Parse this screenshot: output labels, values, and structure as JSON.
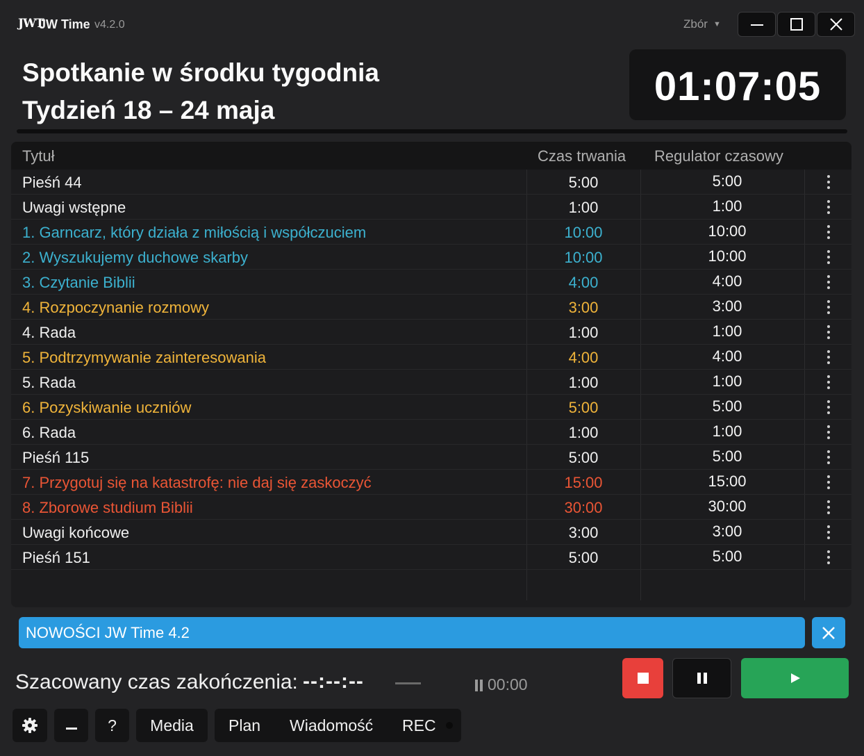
{
  "app": {
    "logo": "JWT",
    "name": "JW Time",
    "version": "v4.2.0",
    "congregation_selector": "Zbór"
  },
  "header": {
    "title_line1": "Spotkanie w środku tygodnia",
    "title_line2": "Tydzień 18 – 24 maja",
    "clock": "01:07:05"
  },
  "table": {
    "columns": {
      "title": "Tytuł",
      "duration": "Czas trwania",
      "regulator": "Regulator czasowy"
    },
    "rows": [
      {
        "title": "Pieśń 44",
        "duration": "5:00",
        "regulator": "5:00",
        "color": "#f0f0f0"
      },
      {
        "title": "Uwagi wstępne",
        "duration": "1:00",
        "regulator": "1:00",
        "color": "#f0f0f0"
      },
      {
        "title": "1. Garncarz, który działa z miłością i współczuciem",
        "duration": "10:00",
        "regulator": "10:00",
        "color": "#3cb1cf"
      },
      {
        "title": "2. Wyszukujemy duchowe skarby",
        "duration": "10:00",
        "regulator": "10:00",
        "color": "#3cb1cf"
      },
      {
        "title": "3. Czytanie Biblii",
        "duration": "4:00",
        "regulator": "4:00",
        "color": "#3cb1cf"
      },
      {
        "title": "4. Rozpoczynanie rozmowy",
        "duration": "3:00",
        "regulator": "3:00",
        "color": "#f0b43a"
      },
      {
        "title": "4. Rada",
        "duration": "1:00",
        "regulator": "1:00",
        "color": "#f0f0f0"
      },
      {
        "title": "5. Podtrzymywanie zainteresowania",
        "duration": "4:00",
        "regulator": "4:00",
        "color": "#f0b43a"
      },
      {
        "title": "5. Rada",
        "duration": "1:00",
        "regulator": "1:00",
        "color": "#f0f0f0"
      },
      {
        "title": "6. Pozyskiwanie uczniów",
        "duration": "5:00",
        "regulator": "5:00",
        "color": "#f0b43a"
      },
      {
        "title": "6. Rada",
        "duration": "1:00",
        "regulator": "1:00",
        "color": "#f0f0f0"
      },
      {
        "title": "Pieśń 115",
        "duration": "5:00",
        "regulator": "5:00",
        "color": "#f0f0f0"
      },
      {
        "title": "7. Przygotuj się na katastrofę: nie daj się zaskoczyć",
        "duration": "15:00",
        "regulator": "15:00",
        "color": "#ea5535"
      },
      {
        "title": "8. Zborowe studium Biblii",
        "duration": "30:00",
        "regulator": "30:00",
        "color": "#ea5535"
      },
      {
        "title": "Uwagi końcowe",
        "duration": "3:00",
        "regulator": "3:00",
        "color": "#f0f0f0"
      },
      {
        "title": "Pieśń 151",
        "duration": "5:00",
        "regulator": "5:00",
        "color": "#f0f0f0"
      }
    ]
  },
  "news_banner": {
    "text": "NOWOŚCI JW Time 4.2"
  },
  "status": {
    "estimated_end_label": "Szacowany czas zakończenia:",
    "estimated_end_value": "--:--:--",
    "pause_timer": "00:00"
  },
  "toolbar": {
    "help": "?",
    "media": "Media",
    "plan": "Plan",
    "message": "Wiadomość",
    "rec": "REC"
  },
  "colors": {
    "background": "#232325",
    "talk_blue": "#3cb1cf",
    "talk_gold": "#f0b43a",
    "talk_red": "#ea5535",
    "banner_blue": "#2b9be0",
    "stop_red": "#e8403b",
    "play_green": "#27a457"
  },
  "icons": [
    "minimize-icon",
    "maximize-icon",
    "close-icon",
    "more-vert-icon",
    "stop-icon",
    "pause-icon",
    "play-icon",
    "gear-icon",
    "minus-icon",
    "record-dot-icon"
  ]
}
